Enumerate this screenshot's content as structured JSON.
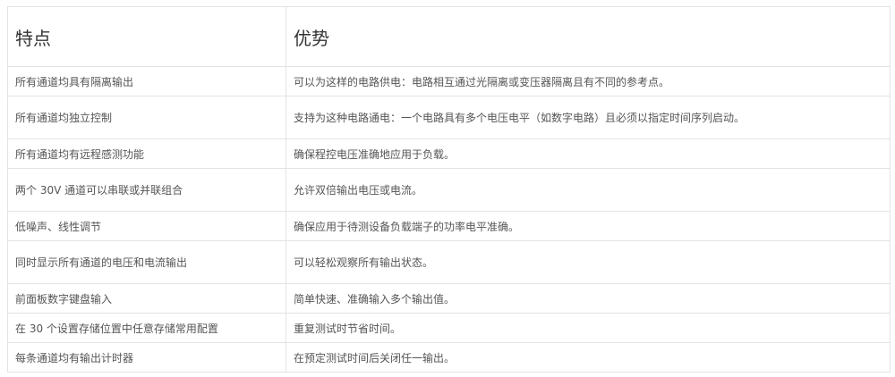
{
  "table": {
    "headers": [
      "特点",
      "优势"
    ],
    "rows": [
      {
        "feature": "所有通道均具有隔离输出",
        "benefit": "可以为这样的电路供电：电路相互通过光隔离或变压器隔离且有不同的参考点。"
      },
      {
        "feature": "所有通道均独立控制",
        "benefit": "支持为这种电路通电：一个电路具有多个电压电平（如数字电路）且必须以指定时间序列启动。"
      },
      {
        "feature": "所有通道均有远程感测功能",
        "benefit": "确保程控电压准确地应用于负载。"
      },
      {
        "feature": "两个 30V 通道可以串联或并联组合",
        "benefit": "允许双倍输出电压或电流。"
      },
      {
        "feature": "低噪声、线性调节",
        "benefit": "确保应用于待测设备负载端子的功率电平准确。"
      },
      {
        "feature": "同时显示所有通道的电压和电流输出",
        "benefit": "可以轻松观察所有输出状态。"
      },
      {
        "feature": "前面板数字键盘输入",
        "benefit": "简单快速、准确输入多个输出值。"
      },
      {
        "feature": "在 30 个设置存储位置中任意存储常用配置",
        "benefit": "重复测试时节省时间。"
      },
      {
        "feature": "每条通道均有输出计时器",
        "benefit": "在预定测试时间后关闭任一输出。"
      }
    ]
  }
}
